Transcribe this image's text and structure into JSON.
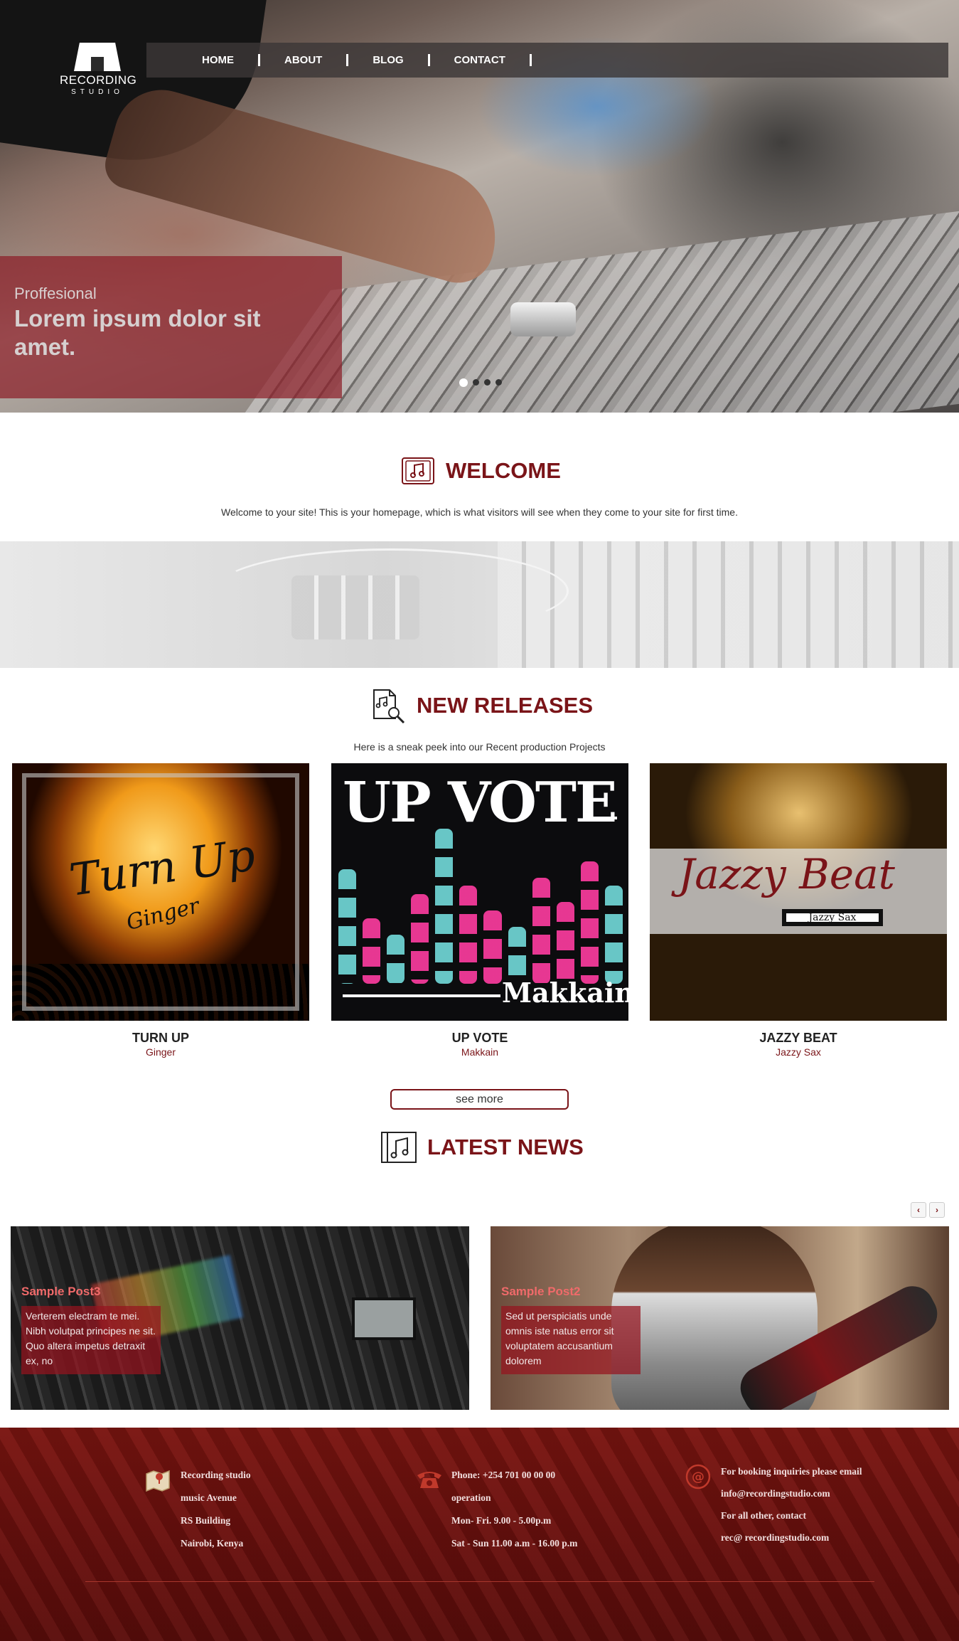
{
  "brand": {
    "name_line1": "RECORDING",
    "name_line2": "STUDIO"
  },
  "nav": {
    "items": [
      "HOME",
      "ABOUT",
      "BLOG",
      "CONTACT"
    ]
  },
  "hero": {
    "kicker": "Proffesional",
    "headline": "Lorem ipsum dolor sit amet.",
    "slides_total": 4,
    "active_slide": 1
  },
  "welcome": {
    "title": "WELCOME",
    "text": "Welcome to your site! This is your homepage, which is what visitors will see when they come to your site for first time."
  },
  "releases": {
    "title": "NEW RELEASES",
    "subtitle": "Here is a sneak peek into our Recent production Projects",
    "items": [
      {
        "name": "TURN UP",
        "artist": "Ginger",
        "cover_script": "Turn Up",
        "cover_sub": "Ginger"
      },
      {
        "name": "UP VOTE",
        "artist": "Makkain",
        "cover_head": "UP VOTE",
        "cover_artist": "Makkain"
      },
      {
        "name": "JAZZY BEAT",
        "artist": "Jazzy Sax",
        "cover_script": "Jazzy Beat",
        "cover_tag": "Jazzy Sax"
      }
    ],
    "see_more": "see more"
  },
  "news": {
    "title": "LATEST NEWS",
    "prev": "‹",
    "next": "›",
    "posts": [
      {
        "title": "Sample Post3",
        "excerpt": "Verterem electram te mei. Nibh volutpat principes ne sit. Quo altera impetus detraxit ex, no"
      },
      {
        "title": "Sample Post2",
        "excerpt": "Sed ut perspiciatis unde omnis iste natus error sit voluptatem accusantium dolorem"
      }
    ]
  },
  "footer": {
    "address": [
      "Recording studio",
      "music Avenue",
      "RS Building",
      "Nairobi, Kenya"
    ],
    "phone": [
      "Phone: +254 701 00 00 00",
      "operation",
      "Mon- Fri. 9.00 - 5.00p.m",
      "Sat - Sun 11.00 a.m - 16.00 p.m"
    ],
    "contact": [
      "For booking inquiries please email",
      "info@recordingstudio.com",
      "For all other, contact",
      "rec@ recordingstudio.com"
    ]
  },
  "colors": {
    "accent": "#7a1418",
    "footer_bg": "#6a100e"
  }
}
